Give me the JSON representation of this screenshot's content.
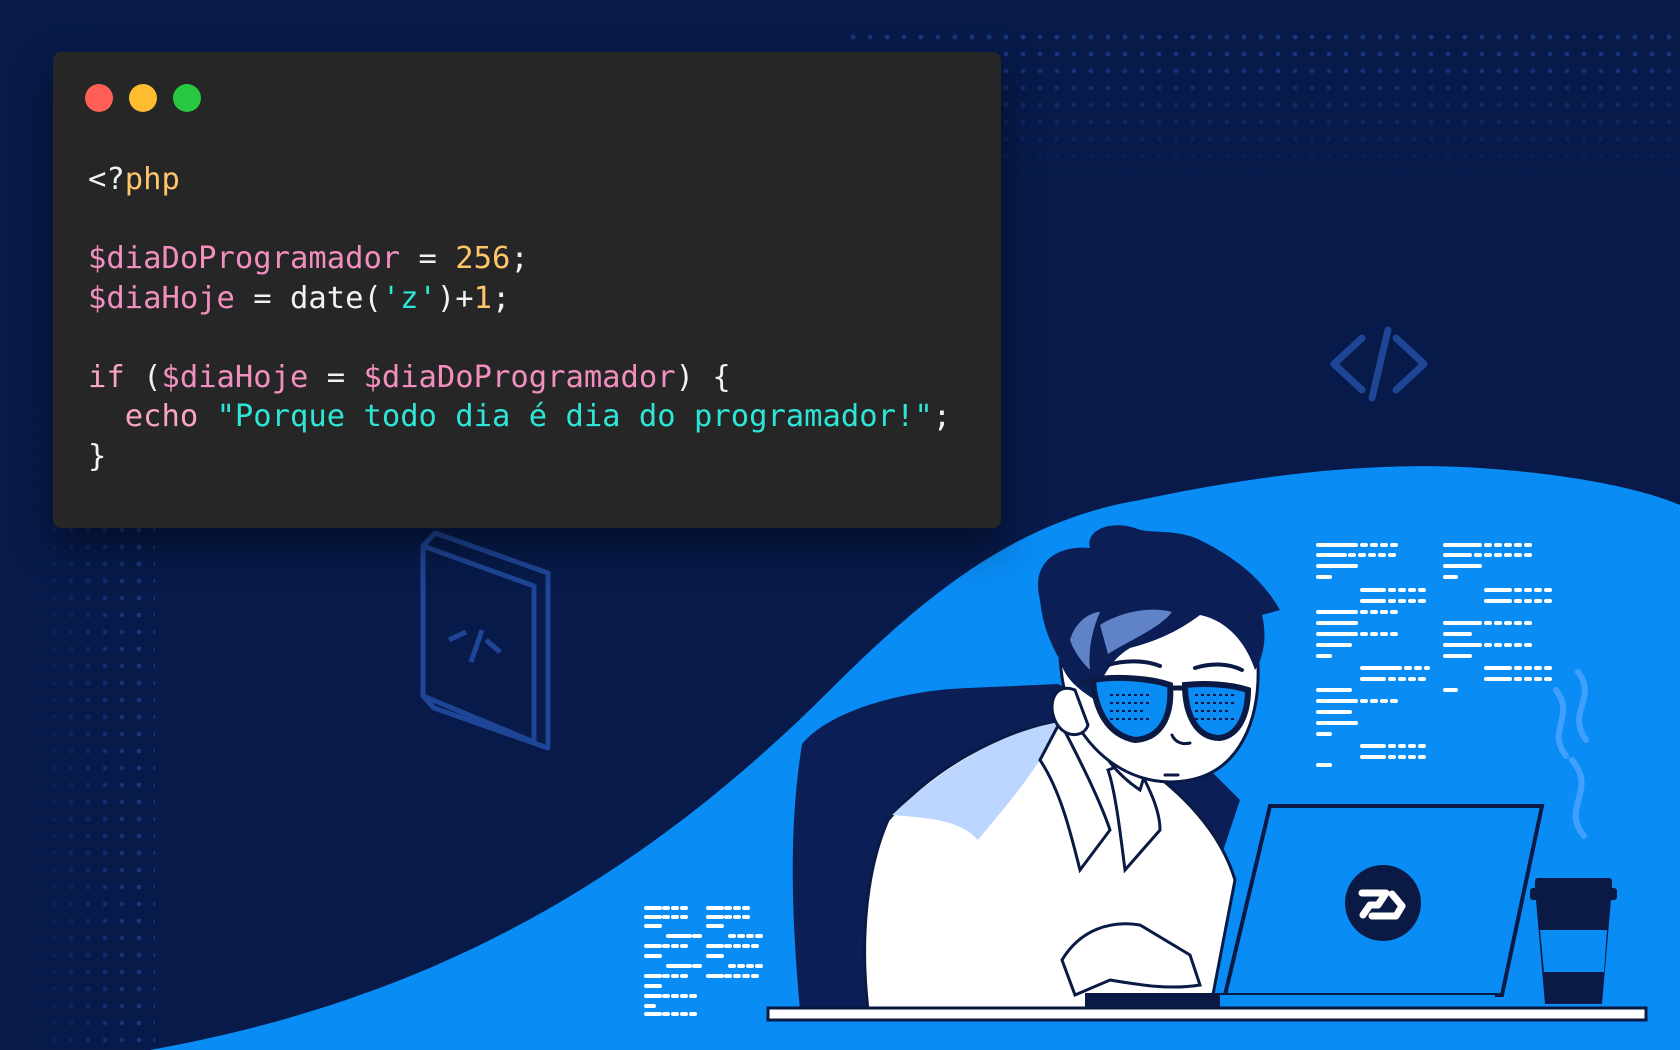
{
  "colors": {
    "background": "#071a4a",
    "wave": "#0a8cf5",
    "editor_bg": "#262626",
    "dot_close": "#ff5f57",
    "dot_minimize": "#febc2e",
    "dot_maximize": "#28c840",
    "variable": "#f38fc0",
    "number": "#ffc56b",
    "string": "#2ee6d6"
  },
  "window": {
    "controls": [
      "close",
      "minimize",
      "maximize"
    ]
  },
  "code": {
    "lines": [
      [
        {
          "t": "default",
          "v": "<?"
        },
        {
          "t": "tag",
          "v": "php"
        }
      ],
      [],
      [
        {
          "t": "variable",
          "v": "$diaDoProgramador"
        },
        {
          "t": "default",
          "v": " = "
        },
        {
          "t": "number",
          "v": "256"
        },
        {
          "t": "default",
          "v": ";"
        }
      ],
      [
        {
          "t": "variable",
          "v": "$diaHoje"
        },
        {
          "t": "default",
          "v": " = date("
        },
        {
          "t": "string",
          "v": "'z'"
        },
        {
          "t": "default",
          "v": ")+"
        },
        {
          "t": "number",
          "v": "1"
        },
        {
          "t": "default",
          "v": ";"
        }
      ],
      [],
      [
        {
          "t": "keyword",
          "v": "if"
        },
        {
          "t": "default",
          "v": " ("
        },
        {
          "t": "variable",
          "v": "$diaHoje"
        },
        {
          "t": "default",
          "v": " = "
        },
        {
          "t": "variable",
          "v": "$diaDoProgramador"
        },
        {
          "t": "default",
          "v": ") {"
        }
      ],
      [
        {
          "t": "default",
          "v": "  "
        },
        {
          "t": "keyword",
          "v": "echo"
        },
        {
          "t": "default",
          "v": " "
        },
        {
          "t": "string",
          "v": "\"Porque todo dia é dia do programador!\""
        },
        {
          "t": "default",
          "v": ";"
        }
      ],
      [
        {
          "t": "default",
          "v": "}"
        }
      ]
    ]
  },
  "decor": {
    "icons": [
      "code-tag-icon",
      "php-file-icon",
      "logo-icon",
      "coffee-cup-icon"
    ],
    "book_label": "<?>",
    "code_tag": "</>"
  }
}
